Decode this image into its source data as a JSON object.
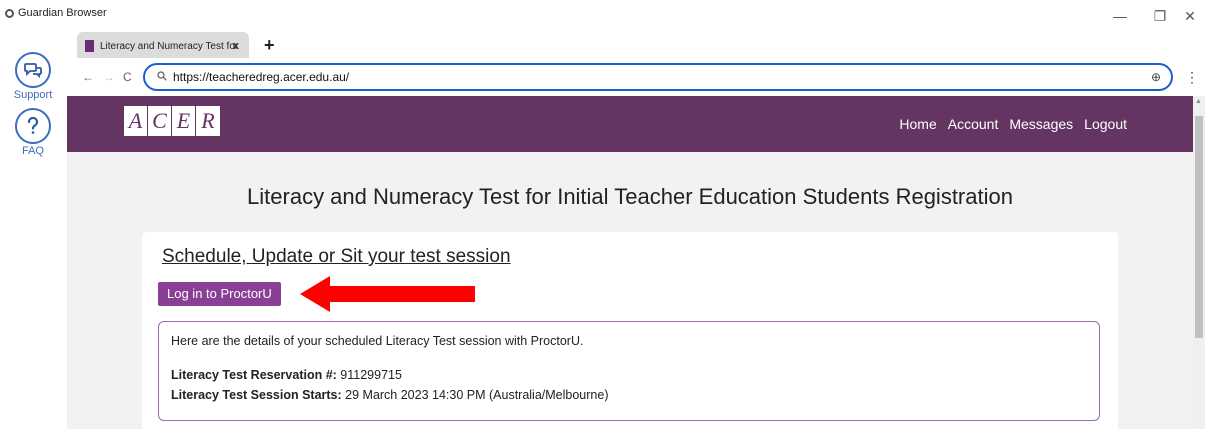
{
  "window": {
    "app_title": "Guardian Browser",
    "controls": {
      "minimize": "—",
      "restore": "❐",
      "close": "✕"
    }
  },
  "rail": {
    "support_label": "Support",
    "faq_label": "FAQ"
  },
  "tab": {
    "title": "Literacy and Numeracy Test for",
    "close": "x",
    "new_tab": "+"
  },
  "navbar": {
    "url": "https://teacheredreg.acer.edu.au/",
    "back": "←",
    "forward": "→",
    "reload": "C",
    "zoom_icon": "⊕",
    "menu": "⋮"
  },
  "site": {
    "logo_letters": [
      "A",
      "C",
      "E",
      "R"
    ],
    "nav": [
      "Home",
      "Account",
      "Messages",
      "Logout"
    ],
    "colors": {
      "header": "#643462",
      "button": "#8a3f97",
      "arrow": "#ff0000"
    }
  },
  "main": {
    "title": "Literacy and Numeracy Test for Initial Teacher Education Students Registration",
    "card_heading": "Schedule, Update or Sit your test session",
    "login_button": "Log in to ProctorU",
    "details_intro": "Here are the details of your scheduled Literacy Test session with ProctorU.",
    "reservation_label": "Literacy Test Reservation #:",
    "reservation_value": "911299715",
    "session_label": "Literacy Test Session Starts:",
    "session_value": "29 March 2023 14:30 PM (Australia/Melbourne)"
  }
}
